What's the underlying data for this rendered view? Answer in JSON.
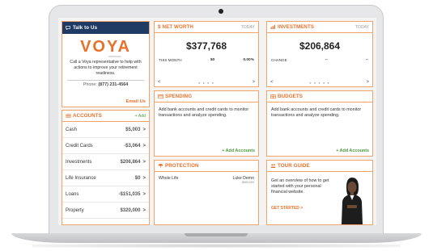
{
  "colors": {
    "accent": "#e8712a",
    "navy": "#1f3a63",
    "green": "#4a9a3a"
  },
  "talk": {
    "title": "Talk to Us",
    "logo": "VOYA",
    "logo_sub": "FINANCIAL",
    "desc": "Call a Voya representative to help with actions to improve your retirement readiness.",
    "phone_label": "Phone:",
    "phone": "(877) 231-4564",
    "email": "Email Us"
  },
  "networth": {
    "title": "NET WORTH",
    "period": "TODAY",
    "value": "$377,768",
    "row_label": "THIS MONTH",
    "row_amount": "$0",
    "row_pct": "0.00%"
  },
  "investments": {
    "title": "INVESTMENTS",
    "period": "TODAY",
    "value": "$206,864",
    "row_label": "CHANGE",
    "row_amount": "--",
    "row_pct": "--"
  },
  "accounts": {
    "title": "ACCOUNTS",
    "add": "+ Add",
    "items": [
      {
        "label": "Cash",
        "value": "$5,003"
      },
      {
        "label": "Credit Cards",
        "value": "-$3,064"
      },
      {
        "label": "Investments",
        "value": "$206,864"
      },
      {
        "label": "Life Insurance",
        "value": "$0"
      },
      {
        "label": "Loans",
        "value": "-$151,035"
      },
      {
        "label": "Property",
        "value": "$320,000"
      }
    ]
  },
  "spending": {
    "title": "SPENDING",
    "text": "Add bank accounts and credit cards to monitor transactions and analyze spending.",
    "add": "+ Add Accounts"
  },
  "budgets": {
    "title": "BUDGETS",
    "text": "Add bank accounts and credit cards to monitor transactions and analyze spending.",
    "add": "+ Add Accounts"
  },
  "protection": {
    "title": "PROTECTION",
    "policy": "Whole Life",
    "owner": "Luke Demo",
    "amount": "$500,000"
  },
  "tour": {
    "title": "TOUR GUIDE",
    "text": "Get an overview of how to get started with your personal financial website.",
    "cta": "GET STARTED >"
  },
  "nav": {
    "prev": "<",
    "next": ">",
    "arrow": ">"
  }
}
